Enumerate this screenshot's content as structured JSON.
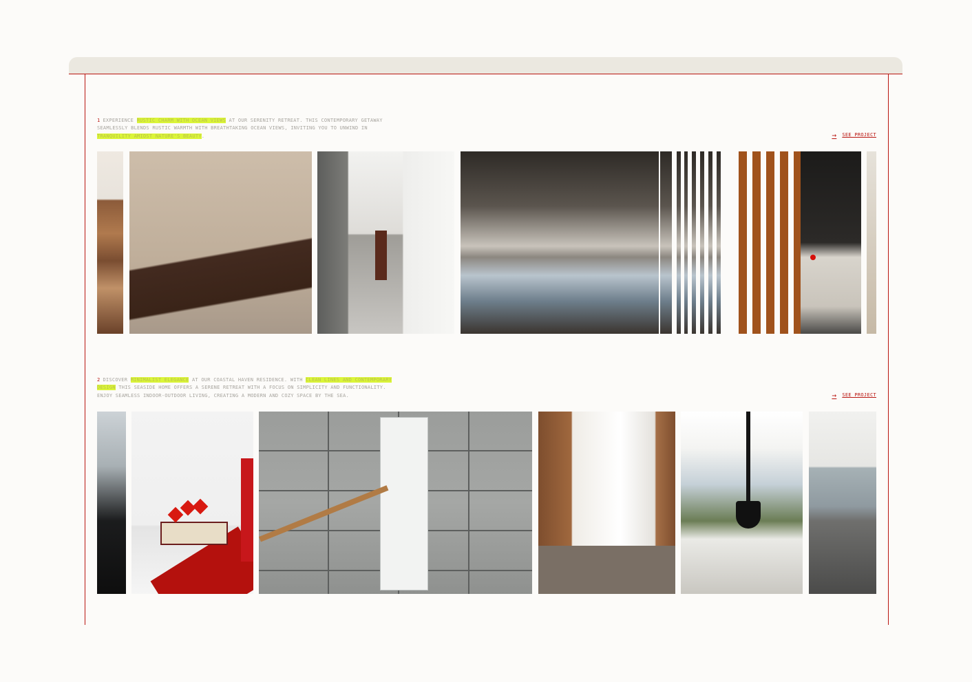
{
  "projects": [
    {
      "number": "1",
      "description_parts": [
        {
          "text": "EXPERIENCE ",
          "hl": false
        },
        {
          "text": "RUSTIC CHARM WITH OCEAN VIEWS",
          "hl": true
        },
        {
          "text": " AT OUR SERENITY RETREAT. THIS CONTEMPORARY GETAWAY SEAMLESSLY BLENDS RUSTIC WARMTH WITH BREATHTAKING OCEAN VIEWS, INVITING YOU TO UNWIND IN ",
          "hl": false
        },
        {
          "text": "TRANQUILITY AMIDST NATURE'S BEAUTY",
          "hl": true
        },
        {
          "text": ".",
          "hl": false
        }
      ],
      "link_label": "SEE PROJECT",
      "arrow": "→"
    },
    {
      "number": "2",
      "description_parts": [
        {
          "text": "DISCOVER ",
          "hl": false
        },
        {
          "text": "MINIMALIST ELEGANCE",
          "hl": true
        },
        {
          "text": " AT OUR COASTAL HAVEN RESIDENCE. WITH ",
          "hl": false
        },
        {
          "text": "CLEAN LINES AND CONTEMPORARY DESIGN",
          "hl": true
        },
        {
          "text": " THIS SEASIDE HOME OFFERS A SERENE RETREAT WITH A FOCUS ON SIMPLICITY AND FUNCTIONALITY. ENJOY SEAMLESS INDOOR-OUTDOOR LIVING, CREATING A MODERN AND COZY SPACE BY THE SEA.",
          "hl": false
        }
      ],
      "link_label": "SEE PROJECT",
      "arrow": "→"
    }
  ],
  "colors": {
    "accent": "#b9140f",
    "highlight": "#dbf538",
    "text": "#a7a49e",
    "background": "#fcfbf9",
    "frame": "#ebe8e0"
  }
}
